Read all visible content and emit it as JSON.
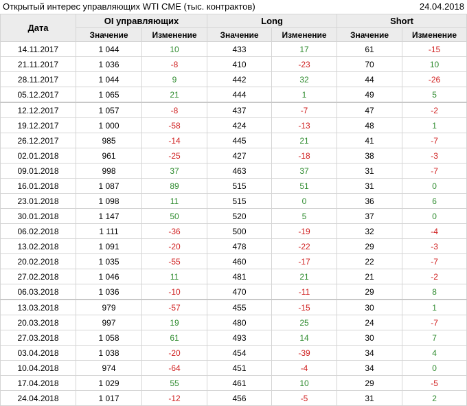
{
  "report": {
    "title": "Открытый интерес управляющих WTI CME (тыс. контрактов)",
    "date": "24.04.2018"
  },
  "table": {
    "date_header": "Дата",
    "groups": [
      "OI управляющих",
      "Long",
      "Short"
    ],
    "sub_headers": [
      "Значение",
      "Изменение",
      "Значение",
      "Изменение",
      "Значение",
      "Изменение"
    ],
    "colors": {
      "positive": "#2e8b2e",
      "negative": "#d02020"
    },
    "rows": [
      {
        "date": "14.11.2017",
        "oi": "1 044",
        "oi_chg": "10",
        "long": "433",
        "long_chg": "17",
        "short": "61",
        "short_chg": "-15"
      },
      {
        "date": "21.11.2017",
        "oi": "1 036",
        "oi_chg": "-8",
        "long": "410",
        "long_chg": "-23",
        "short": "70",
        "short_chg": "10"
      },
      {
        "date": "28.11.2017",
        "oi": "1 044",
        "oi_chg": "9",
        "long": "442",
        "long_chg": "32",
        "short": "44",
        "short_chg": "-26"
      },
      {
        "date": "05.12.2017",
        "oi": "1 065",
        "oi_chg": "21",
        "long": "444",
        "long_chg": "1",
        "short": "49",
        "short_chg": "5"
      },
      {
        "date": "12.12.2017",
        "oi": "1 057",
        "oi_chg": "-8",
        "long": "437",
        "long_chg": "-7",
        "short": "47",
        "short_chg": "-2"
      },
      {
        "date": "19.12.2017",
        "oi": "1 000",
        "oi_chg": "-58",
        "long": "424",
        "long_chg": "-13",
        "short": "48",
        "short_chg": "1"
      },
      {
        "date": "26.12.2017",
        "oi": "985",
        "oi_chg": "-14",
        "long": "445",
        "long_chg": "21",
        "short": "41",
        "short_chg": "-7"
      },
      {
        "date": "02.01.2018",
        "oi": "961",
        "oi_chg": "-25",
        "long": "427",
        "long_chg": "-18",
        "short": "38",
        "short_chg": "-3"
      },
      {
        "date": "09.01.2018",
        "oi": "998",
        "oi_chg": "37",
        "long": "463",
        "long_chg": "37",
        "short": "31",
        "short_chg": "-7"
      },
      {
        "date": "16.01.2018",
        "oi": "1 087",
        "oi_chg": "89",
        "long": "515",
        "long_chg": "51",
        "short": "31",
        "short_chg": "0"
      },
      {
        "date": "23.01.2018",
        "oi": "1 098",
        "oi_chg": "11",
        "long": "515",
        "long_chg": "0",
        "short": "36",
        "short_chg": "6"
      },
      {
        "date": "30.01.2018",
        "oi": "1 147",
        "oi_chg": "50",
        "long": "520",
        "long_chg": "5",
        "short": "37",
        "short_chg": "0"
      },
      {
        "date": "06.02.2018",
        "oi": "1 111",
        "oi_chg": "-36",
        "long": "500",
        "long_chg": "-19",
        "short": "32",
        "short_chg": "-4"
      },
      {
        "date": "13.02.2018",
        "oi": "1 091",
        "oi_chg": "-20",
        "long": "478",
        "long_chg": "-22",
        "short": "29",
        "short_chg": "-3"
      },
      {
        "date": "20.02.2018",
        "oi": "1 035",
        "oi_chg": "-55",
        "long": "460",
        "long_chg": "-17",
        "short": "22",
        "short_chg": "-7"
      },
      {
        "date": "27.02.2018",
        "oi": "1 046",
        "oi_chg": "11",
        "long": "481",
        "long_chg": "21",
        "short": "21",
        "short_chg": "-2"
      },
      {
        "date": "06.03.2018",
        "oi": "1 036",
        "oi_chg": "-10",
        "long": "470",
        "long_chg": "-11",
        "short": "29",
        "short_chg": "8"
      },
      {
        "date": "13.03.2018",
        "oi": "979",
        "oi_chg": "-57",
        "long": "455",
        "long_chg": "-15",
        "short": "30",
        "short_chg": "1"
      },
      {
        "date": "20.03.2018",
        "oi": "997",
        "oi_chg": "19",
        "long": "480",
        "long_chg": "25",
        "short": "24",
        "short_chg": "-7"
      },
      {
        "date": "27.03.2018",
        "oi": "1 058",
        "oi_chg": "61",
        "long": "493",
        "long_chg": "14",
        "short": "30",
        "short_chg": "7"
      },
      {
        "date": "03.04.2018",
        "oi": "1 038",
        "oi_chg": "-20",
        "long": "454",
        "long_chg": "-39",
        "short": "34",
        "short_chg": "4"
      },
      {
        "date": "10.04.2018",
        "oi": "974",
        "oi_chg": "-64",
        "long": "451",
        "long_chg": "-4",
        "short": "34",
        "short_chg": "0"
      },
      {
        "date": "17.04.2018",
        "oi": "1 029",
        "oi_chg": "55",
        "long": "461",
        "long_chg": "10",
        "short": "29",
        "short_chg": "-5"
      },
      {
        "date": "24.04.2018",
        "oi": "1 017",
        "oi_chg": "-12",
        "long": "456",
        "long_chg": "-5",
        "short": "31",
        "short_chg": "2"
      }
    ]
  }
}
